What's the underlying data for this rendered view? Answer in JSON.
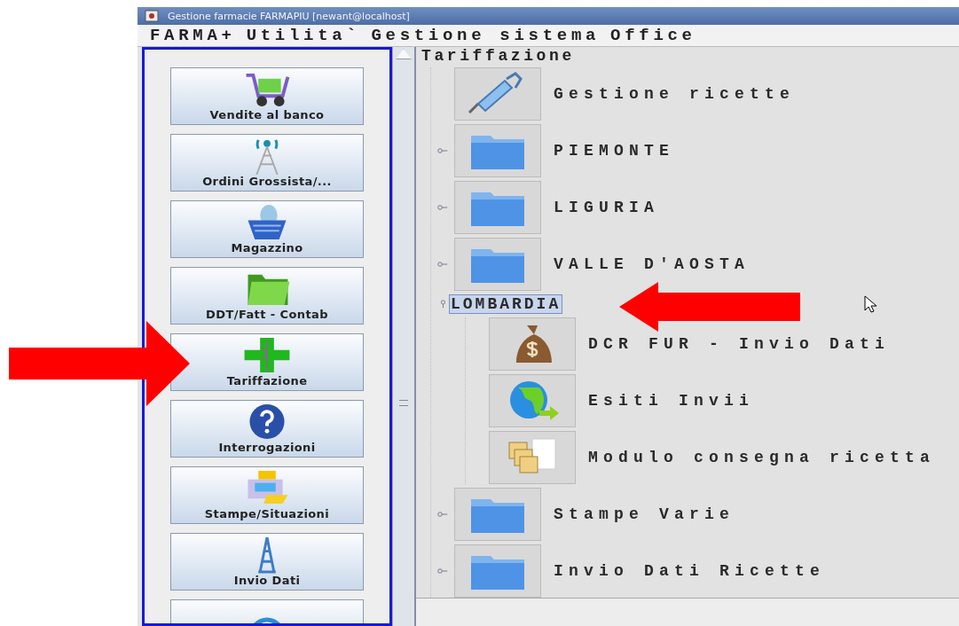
{
  "window": {
    "title": "Gestione farmacie FARMAPIU [newant@localhost]"
  },
  "menu": [
    "FARMA+",
    "Utilita`",
    "Gestione sistema",
    "Office"
  ],
  "sidebar": {
    "buttons": [
      {
        "label": "Vendite al banco"
      },
      {
        "label": "Ordini Grossista/..."
      },
      {
        "label": "Magazzino"
      },
      {
        "label": "DDT/Fatt - Contab"
      },
      {
        "label": "Tariffazione"
      },
      {
        "label": "Interrogazioni"
      },
      {
        "label": "Stampe/Situazioni"
      },
      {
        "label": "Invio Dati"
      }
    ]
  },
  "tree": {
    "root": "Tariffazione",
    "nodes": [
      {
        "kind": "action",
        "label": "Gestione ricette"
      },
      {
        "kind": "folder",
        "label": "PIEMONTE",
        "expanded": false
      },
      {
        "kind": "folder",
        "label": "LIGURIA",
        "expanded": false
      },
      {
        "kind": "folder",
        "label": "VALLE D'AOSTA",
        "expanded": false
      },
      {
        "kind": "group",
        "label": "LOMBARDIA",
        "expanded": true,
        "selected": true,
        "children": [
          {
            "kind": "action",
            "label": "DCR FUR - Invio Dati"
          },
          {
            "kind": "action",
            "label": "Esiti Invii"
          },
          {
            "kind": "action",
            "label": "Modulo consegna ricetta"
          }
        ]
      },
      {
        "kind": "folder",
        "label": "Stampe Varie",
        "expanded": false
      },
      {
        "kind": "folder",
        "label": "Invio Dati Ricette",
        "expanded": false
      }
    ]
  }
}
